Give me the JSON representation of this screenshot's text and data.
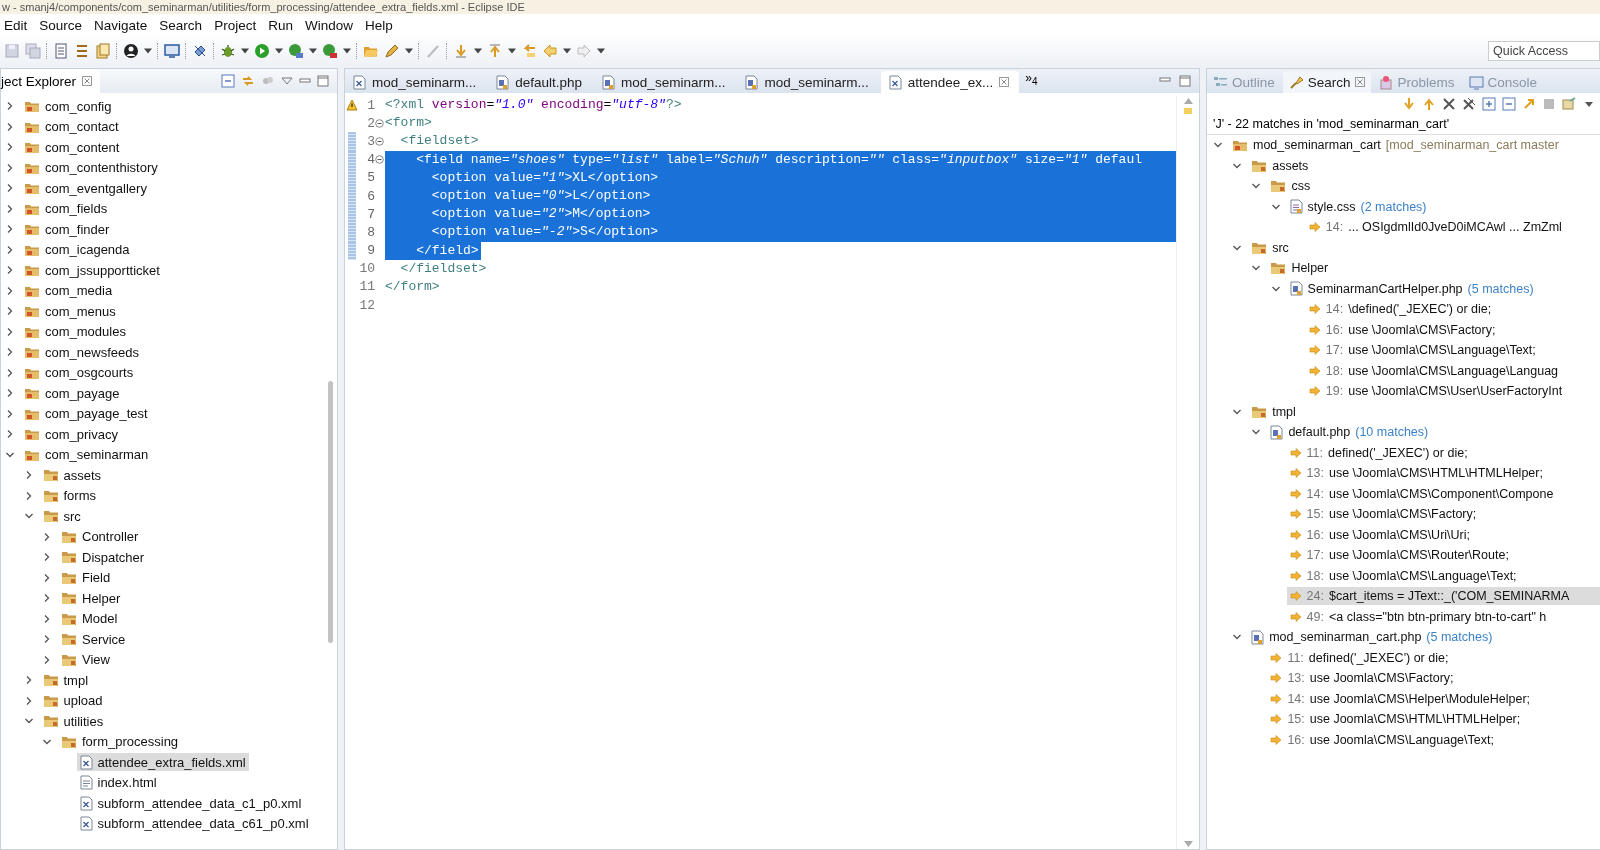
{
  "window": {
    "title": "w - smanj4/components/com_seminarman/utilities/form_processing/attendee_extra_fields.xml - Eclipse IDE"
  },
  "menu": [
    "Edit",
    "Source",
    "Navigate",
    "Search",
    "Project",
    "Run",
    "Window",
    "Help"
  ],
  "quick_access": {
    "placeholder": "Quick Access"
  },
  "explorer": {
    "title": "ject Explorer",
    "tree": [
      {
        "label": "com_config",
        "kind": "project",
        "expanded": false,
        "selected": false
      },
      {
        "label": "com_contact",
        "kind": "project",
        "expanded": false,
        "selected": false
      },
      {
        "label": "com_content",
        "kind": "project",
        "expanded": false,
        "selected": false
      },
      {
        "label": "com_contenthistory",
        "kind": "project",
        "expanded": false,
        "selected": false
      },
      {
        "label": "com_eventgallery",
        "kind": "project",
        "expanded": false,
        "selected": false
      },
      {
        "label": "com_fields",
        "kind": "project",
        "expanded": false,
        "selected": false
      },
      {
        "label": "com_finder",
        "kind": "project",
        "expanded": false,
        "selected": false
      },
      {
        "label": "com_icagenda",
        "kind": "project",
        "expanded": false,
        "selected": false
      },
      {
        "label": "com_jssupportticket",
        "kind": "project",
        "expanded": false,
        "selected": false
      },
      {
        "label": "com_media",
        "kind": "project",
        "expanded": false,
        "selected": false
      },
      {
        "label": "com_menus",
        "kind": "project",
        "expanded": false,
        "selected": false
      },
      {
        "label": "com_modules",
        "kind": "project",
        "expanded": false,
        "selected": false
      },
      {
        "label": "com_newsfeeds",
        "kind": "project",
        "expanded": false,
        "selected": false
      },
      {
        "label": "com_osgcourts",
        "kind": "project",
        "expanded": false,
        "selected": false
      },
      {
        "label": "com_payage",
        "kind": "project",
        "expanded": false,
        "selected": false
      },
      {
        "label": "com_payage_test",
        "kind": "project",
        "expanded": false,
        "selected": false
      },
      {
        "label": "com_privacy",
        "kind": "project",
        "expanded": false,
        "selected": false
      },
      {
        "label": "com_seminarman",
        "kind": "project",
        "expanded": true,
        "selected": false,
        "children": [
          {
            "label": "assets",
            "kind": "folder",
            "expanded": false,
            "selected": false
          },
          {
            "label": "forms",
            "kind": "folder",
            "expanded": false,
            "selected": false
          },
          {
            "label": "src",
            "kind": "folder",
            "expanded": true,
            "selected": false,
            "children": [
              {
                "label": "Controller",
                "kind": "folder",
                "expanded": false,
                "selected": false
              },
              {
                "label": "Dispatcher",
                "kind": "folder",
                "expanded": false,
                "selected": false
              },
              {
                "label": "Field",
                "kind": "folder",
                "expanded": false,
                "selected": false
              },
              {
                "label": "Helper",
                "kind": "folder",
                "expanded": false,
                "selected": false
              },
              {
                "label": "Model",
                "kind": "folder",
                "expanded": false,
                "selected": false
              },
              {
                "label": "Service",
                "kind": "folder",
                "expanded": false,
                "selected": false
              },
              {
                "label": "View",
                "kind": "folder",
                "expanded": false,
                "selected": false
              }
            ]
          },
          {
            "label": "tmpl",
            "kind": "folder",
            "expanded": false,
            "selected": false
          },
          {
            "label": "upload",
            "kind": "folder",
            "expanded": false,
            "selected": false
          },
          {
            "label": "utilities",
            "kind": "folder",
            "expanded": true,
            "selected": false,
            "children": [
              {
                "label": "form_processing",
                "kind": "folder",
                "expanded": true,
                "selected": false,
                "children": [
                  {
                    "label": "attendee_extra_fields.xml",
                    "kind": "xml",
                    "selected": true
                  },
                  {
                    "label": "index.html",
                    "kind": "html",
                    "selected": false
                  },
                  {
                    "label": "subform_attendee_data_c1_p0.xml",
                    "kind": "xml",
                    "selected": false
                  },
                  {
                    "label": "subform_attendee_data_c61_p0.xml",
                    "kind": "xml",
                    "selected": false
                  }
                ]
              }
            ]
          }
        ]
      }
    ]
  },
  "editor": {
    "tabs": [
      {
        "label": "mod_seminarm...",
        "kind": "xml",
        "selected": false
      },
      {
        "label": "default.php",
        "kind": "php",
        "selected": false
      },
      {
        "label": "mod_seminarm...",
        "kind": "php",
        "selected": false
      },
      {
        "label": "mod_seminarm...",
        "kind": "php",
        "selected": false
      },
      {
        "label": "attendee_ex...",
        "kind": "xml",
        "selected": true
      }
    ],
    "overflow": "»$_{4}$",
    "lines": [
      {
        "number": "1",
        "text": "<?xml version=\"1.0\" encoding=\"utf-8\"?>",
        "warning": true,
        "foldable": false,
        "changed": false,
        "selected": false
      },
      {
        "number": "2",
        "text": "<form>",
        "warning": false,
        "foldable": true,
        "changed": false,
        "selected": false
      },
      {
        "number": "3",
        "text": "  <fieldset>",
        "warning": false,
        "foldable": true,
        "changed": true,
        "selected": false
      },
      {
        "number": "4",
        "text": "    <field name=\"shoes\" type=\"list\" label=\"Schuh\" description=\"\" class=\"inputbox\" size=\"1\" defaul",
        "warning": false,
        "foldable": true,
        "changed": true,
        "selected": true
      },
      {
        "number": "5",
        "text": "      <option value=\"1\">XL</option>",
        "warning": false,
        "foldable": false,
        "changed": true,
        "selected": true
      },
      {
        "number": "6",
        "text": "      <option value=\"0\">L</option>",
        "warning": false,
        "foldable": false,
        "changed": true,
        "selected": true
      },
      {
        "number": "7",
        "text": "      <option value=\"2\">M</option>",
        "warning": false,
        "foldable": false,
        "changed": true,
        "selected": true
      },
      {
        "number": "8",
        "text": "      <option value=\"-2\">S</option>",
        "warning": false,
        "foldable": false,
        "changed": true,
        "selected": true
      },
      {
        "number": "9",
        "text": "    </field>",
        "warning": false,
        "foldable": false,
        "changed": true,
        "selected": true
      },
      {
        "number": "10",
        "text": "  </fieldset>",
        "warning": false,
        "foldable": false,
        "changed": false,
        "selected": false
      },
      {
        "number": "11",
        "text": "</form>",
        "warning": false,
        "foldable": false,
        "changed": false,
        "selected": false
      },
      {
        "number": "12",
        "warning": false,
        "foldable": false,
        "changed": false,
        "selected": false
      }
    ]
  },
  "search": {
    "tabs": [
      {
        "label": "Outline",
        "kind": "outline",
        "selected": false
      },
      {
        "label": "Search",
        "kind": "search",
        "selected": true
      },
      {
        "label": "Problems",
        "kind": "problems",
        "selected": false
      },
      {
        "label": "Console",
        "kind": "console",
        "selected": false
      }
    ],
    "summary": "'J' - 22 matches in 'mod_seminarman_cart'",
    "tree": [
      {
        "label": "mod_seminarman_cart",
        "decoration": "[mod_seminarman_cart master",
        "kind": "project",
        "expanded": true,
        "selected": false,
        "children": [
          {
            "label": "assets",
            "kind": "folder",
            "expanded": true,
            "selected": false,
            "children": [
              {
                "label": "css",
                "kind": "folder",
                "expanded": true,
                "selected": false,
                "children": [
                  {
                    "label": "style.css",
                    "matches": "(2 matches)",
                    "kind": "css",
                    "expanded": true,
                    "selected": false,
                    "children": [
                      {
                        "line": "14:",
                        "label": "... OSIgdmlId0JveD0iMCAwl ... ZmZml",
                        "kind": "match",
                        "selected": false
                      }
                    ]
                  }
                ]
              }
            ]
          },
          {
            "label": "src",
            "kind": "folder",
            "expanded": true,
            "selected": false,
            "children": [
              {
                "label": "Helper",
                "kind": "folder",
                "expanded": true,
                "selected": false,
                "children": [
                  {
                    "label": "SeminarmanCartHelper.php",
                    "matches": "(5 matches)",
                    "kind": "php",
                    "expanded": true,
                    "selected": false,
                    "children": [
                      {
                        "line": "14:",
                        "label": "\\defined('_JEXEC') or die;",
                        "kind": "match",
                        "selected": false
                      },
                      {
                        "line": "16:",
                        "label": "use \\Joomla\\CMS\\Factory;",
                        "kind": "match",
                        "selected": false
                      },
                      {
                        "line": "17:",
                        "label": "use \\Joomla\\CMS\\Language\\Text;",
                        "kind": "match",
                        "selected": false
                      },
                      {
                        "line": "18:",
                        "label": "use \\Joomla\\CMS\\Language\\Languag",
                        "kind": "match",
                        "selected": false
                      },
                      {
                        "line": "19:",
                        "label": "use \\Joomla\\CMS\\User\\UserFactoryInt",
                        "kind": "match",
                        "selected": false
                      }
                    ]
                  }
                ]
              }
            ]
          },
          {
            "label": "tmpl",
            "kind": "folder",
            "expanded": true,
            "selected": false,
            "children": [
              {
                "label": "default.php",
                "matches": "(10 matches)",
                "kind": "php",
                "expanded": true,
                "selected": false,
                "children": [
                  {
                    "line": "11:",
                    "label": "defined('_JEXEC') or die;",
                    "kind": "match",
                    "selected": false
                  },
                  {
                    "line": "13:",
                    "label": "use \\Joomla\\CMS\\HTML\\HTMLHelper;",
                    "kind": "match",
                    "selected": false
                  },
                  {
                    "line": "14:",
                    "label": "use \\Joomla\\CMS\\Component\\Compone",
                    "kind": "match",
                    "selected": false
                  },
                  {
                    "line": "15:",
                    "label": "use \\Joomla\\CMS\\Factory;",
                    "kind": "match",
                    "selected": false
                  },
                  {
                    "line": "16:",
                    "label": "use \\Joomla\\CMS\\Uri\\Uri;",
                    "kind": "match",
                    "selected": false
                  },
                  {
                    "line": "17:",
                    "label": "use \\Joomla\\CMS\\Router\\Route;",
                    "kind": "match",
                    "selected": false
                  },
                  {
                    "line": "18:",
                    "label": "use \\Joomla\\CMS\\Language\\Text;",
                    "kind": "match",
                    "selected": false
                  },
                  {
                    "line": "24:",
                    "label": "$cart_items = JText::_('COM_SEMINARMA",
                    "kind": "match",
                    "selected": true
                  },
                  {
                    "line": "49:",
                    "label": "<a class=\"btn btn-primary btn-to-cart\" h",
                    "kind": "match",
                    "selected": false
                  }
                ]
              }
            ]
          },
          {
            "label": "mod_seminarman_cart.php",
            "matches": "(5 matches)",
            "kind": "php",
            "expanded": true,
            "selected": false,
            "children": [
              {
                "line": "11:",
                "label": "defined('_JEXEC') or die;",
                "kind": "match",
                "selected": false
              },
              {
                "line": "13:",
                "label": "use Joomla\\CMS\\Factory;",
                "kind": "match",
                "selected": false
              },
              {
                "line": "14:",
                "label": "use Joomla\\CMS\\Helper\\ModuleHelper;",
                "kind": "match",
                "selected": false
              },
              {
                "line": "15:",
                "label": "use Joomla\\CMS\\HTML\\HTMLHelper;",
                "kind": "match",
                "selected": false
              },
              {
                "line": "16:",
                "label": "use Joomla\\CMS\\Language\\Text;",
                "kind": "match",
                "selected": false
              }
            ]
          }
        ]
      }
    ]
  }
}
